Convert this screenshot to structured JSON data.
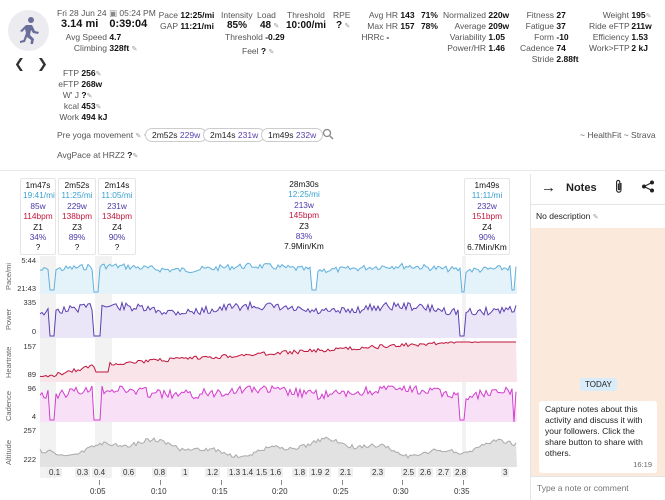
{
  "header": {
    "date": "Fri 28 Jun 24",
    "time": "05:24 PM",
    "distance": "3.14 mi",
    "duration": "0:39:04",
    "avg_speed_label": "Avg Speed",
    "avg_speed": "4.7",
    "climbing_label": "Climbing",
    "climbing": "328ft"
  },
  "metrics": {
    "pace_label": "Pace",
    "pace": "12:25/mi",
    "gap_label": "GAP",
    "gap": "11:21/mi",
    "intensity_label": "Intensity",
    "intensity": "85%",
    "load_label": "Load",
    "load": "48",
    "threshold_label": "Threshold",
    "threshold": "10:00/mi",
    "rpe_label": "RPE",
    "rpe": "?",
    "threshold2_label": "Threshold",
    "threshold2": "-0.29",
    "feel_label": "Feel",
    "feel": "?",
    "avg_hr_label": "Avg HR",
    "avg_hr": "143",
    "avg_hr_pct": "71%",
    "max_hr_label": "Max HR",
    "max_hr": "157",
    "max_hr_pct": "78%",
    "hrrc_label": "HRRc",
    "hrrc": "-",
    "normalized_label": "Normalized",
    "normalized": "220w",
    "average_label": "Average",
    "average": "209w",
    "variability_label": "Variability",
    "variability": "1.05",
    "power_hr_label": "Power/HR",
    "power_hr": "1.46",
    "fitness_label": "Fitness",
    "fitness": "27",
    "fatigue_label": "Fatigue",
    "fatigue": "37",
    "form_label": "Form",
    "form": "-10",
    "cadence_label": "Cadence",
    "cadence": "74",
    "stride_label": "Stride",
    "stride": "2.88ft",
    "weight_label": "Weight",
    "weight": "195",
    "ride_eftp_label": "Ride eFTP",
    "ride_eftp": "211w",
    "efficiency_label": "Efficiency",
    "efficiency": "1.53",
    "work_ftp_label": "Work>FTP",
    "work_ftp": "2 kJ"
  },
  "power_block": {
    "ftp_label": "FTP",
    "ftp": "256",
    "eftp_label": "eFTP",
    "eftp": "268w",
    "wj_label": "W' J",
    "wj": "?",
    "kcal_label": "kcal",
    "kcal": "453",
    "work_label": "Work",
    "work": "494 kJ"
  },
  "pre_yoga": {
    "label": "Pre yoga movement",
    "chips": [
      {
        "time": "2m52s",
        "watts": "229w"
      },
      {
        "time": "2m14s",
        "watts": "231w"
      },
      {
        "time": "1m49s",
        "watts": "232w"
      }
    ],
    "source": "~ HealthFit ~ Strava"
  },
  "avg_pace_label": "AvgPace at HRZ2",
  "avg_pace_value": "?",
  "laps": [
    {
      "dur": "1m47s",
      "pace": "19:41/mi",
      "pow": "85w",
      "hr": "114bpm",
      "z": "Z1",
      "pct": "34%",
      "pc": "?"
    },
    {
      "dur": "2m52s",
      "pace": "11:25/mi",
      "pow": "229w",
      "hr": "138bpm",
      "z": "Z3",
      "pct": "89%",
      "pc": "?"
    },
    {
      "dur": "2m14s",
      "pace": "11:05/mi",
      "pow": "231w",
      "hr": "134bpm",
      "z": "Z4",
      "pct": "90%",
      "pc": "?"
    },
    {
      "dur": "28m30s",
      "pace": "12:25/mi",
      "pow": "213w",
      "hr": "145bpm",
      "z": "Z3",
      "pct": "83%",
      "pc": "7.9Min/Km"
    },
    {
      "dur": "1m49s",
      "pace": "11:11/mi",
      "pow": "232w",
      "hr": "151bpm",
      "z": "Z4",
      "pct": "90%",
      "pc": "6.7Min/Km"
    }
  ],
  "charts": {
    "pace": {
      "label": "Pace/mi",
      "top": "5:44",
      "bottom": "21:43",
      "color": "#5fb0dc",
      "fill": "#e4f2fa"
    },
    "power": {
      "label": "Power",
      "top": "335",
      "bottom": "0",
      "color": "#5b3fb0",
      "fill": "#ebe6f7"
    },
    "hr": {
      "label": "Heartrate",
      "top": "157",
      "bottom": "89",
      "color": "#c0163c",
      "fill": "#f8e4e9"
    },
    "cadence": {
      "label": "Cadence",
      "top": "96",
      "bottom": "4",
      "color": "#d43ccf",
      "fill": "#f8e1f7"
    },
    "altitude": {
      "label": "Altitude",
      "top": "257",
      "bottom": "222",
      "color": "#aaaaaa",
      "fill": "#e2e2e2"
    }
  },
  "distance_labels": [
    "0.1",
    "0.3",
    "0.4",
    "0.6",
    "0.8",
    "1",
    "1.2",
    "1.3",
    "1.4",
    "1.5",
    "1.6",
    "1.8",
    "1.9",
    "2",
    "2.1",
    "2.3",
    "2.5",
    "2.6",
    "2.7",
    "2.8",
    "3"
  ],
  "time_ticks": [
    "0:05",
    "0:10",
    "0:15",
    "0:20",
    "0:25",
    "0:30",
    "0:35"
  ],
  "notes": {
    "title": "Notes",
    "description": "No description",
    "date_badge": "TODAY",
    "message": "Capture notes about this activity and discuss it with your followers. Click the share button to share with others.",
    "message_time": "16:19",
    "input_placeholder": "Type a note or comment"
  }
}
